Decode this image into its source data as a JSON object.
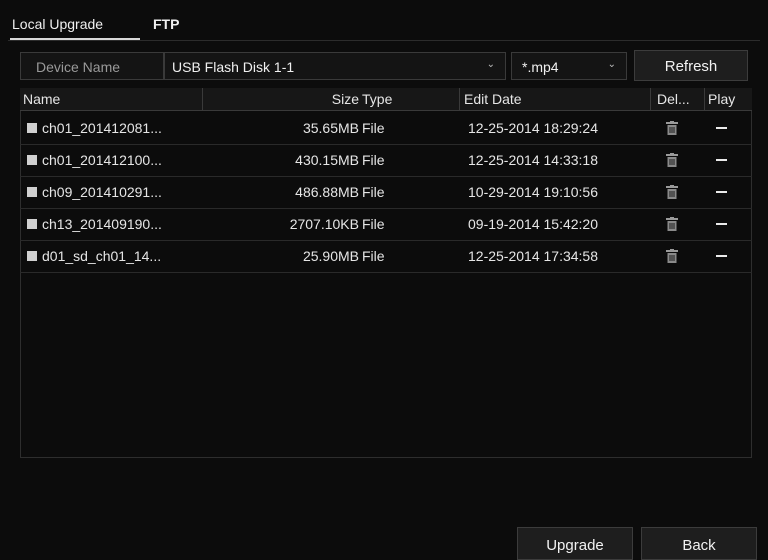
{
  "tabs": [
    {
      "label": "Local Upgrade",
      "active": true
    },
    {
      "label": "FTP",
      "active": false
    }
  ],
  "device": {
    "label": "Device Name",
    "selected": "USB Flash Disk 1-1",
    "filter": "*.mp4",
    "refresh_label": "Refresh"
  },
  "table": {
    "headers": {
      "name": "Name",
      "size": "Size",
      "type": "Type",
      "edit_date": "Edit Date",
      "delete": "Del...",
      "play": "Play"
    },
    "rows": [
      {
        "name": "ch01_201412081...",
        "size": "35.65MB",
        "type": "File",
        "edit_date": "12-25-2014 18:29:24"
      },
      {
        "name": "ch01_201412100...",
        "size": "430.15MB",
        "type": "File",
        "edit_date": "12-25-2014 14:33:18"
      },
      {
        "name": "ch09_201410291...",
        "size": "486.88MB",
        "type": "File",
        "edit_date": "10-29-2014 19:10:56"
      },
      {
        "name": "ch13_201409190...",
        "size": "2707.10KB",
        "type": "File",
        "edit_date": "09-19-2014 15:42:20"
      },
      {
        "name": "d01_sd_ch01_14...",
        "size": "25.90MB",
        "type": "File",
        "edit_date": "12-25-2014 17:34:58"
      }
    ]
  },
  "footer": {
    "upgrade_label": "Upgrade",
    "back_label": "Back"
  },
  "icons": {
    "file": "file-icon",
    "delete": "trash-icon",
    "play": "dash-icon"
  }
}
